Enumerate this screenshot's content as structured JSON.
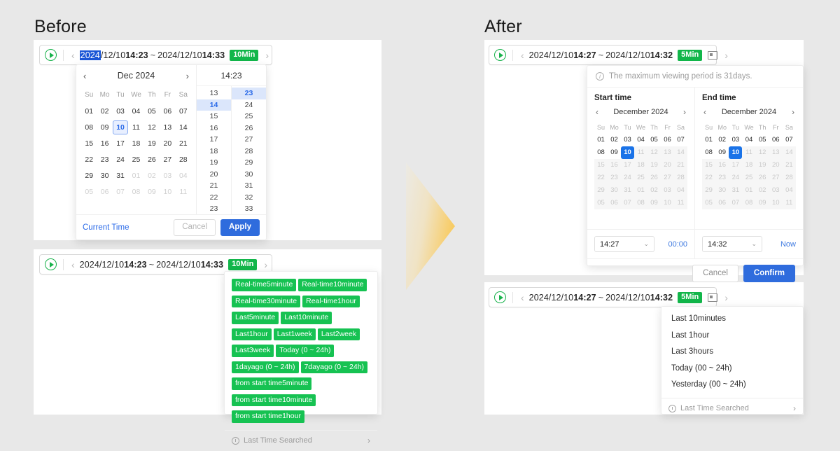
{
  "headings": {
    "before": "Before",
    "after": "After"
  },
  "icons": {
    "play": "play-circle-icon",
    "prev": "‹",
    "next": "›",
    "chevron_down": "⌄",
    "clock": "clock-history-icon",
    "info": "i"
  },
  "before": {
    "bar1": {
      "year_selected": "2024",
      "start_rest": "/12/10",
      "start_time": "14:23",
      "tilde": "~",
      "end_date": "2024/12/10",
      "end_time": "14:33",
      "interval_badge": "10Min"
    },
    "picker": {
      "cal_prev": "‹",
      "cal_label": "Dec 2024",
      "cal_next": "›",
      "dow": [
        "Su",
        "Mo",
        "Tu",
        "We",
        "Th",
        "Fr",
        "Sa"
      ],
      "weeks": [
        [
          "01",
          "02",
          "03",
          "04",
          "05",
          "06",
          "07"
        ],
        [
          "08",
          "09",
          "10",
          "11",
          "12",
          "13",
          "14"
        ],
        [
          "15",
          "16",
          "17",
          "18",
          "19",
          "20",
          "21"
        ],
        [
          "22",
          "23",
          "24",
          "25",
          "26",
          "27",
          "28"
        ],
        [
          "29",
          "30",
          "31",
          "01",
          "02",
          "03",
          "04"
        ],
        [
          "05",
          "06",
          "07",
          "08",
          "09",
          "10",
          "11"
        ]
      ],
      "selected_day": "10",
      "time_header": "14:23",
      "hours": [
        "13",
        "14",
        "15",
        "16",
        "17",
        "18",
        "19",
        "20",
        "21",
        "22",
        "23"
      ],
      "hour_selected": "14",
      "minutes": [
        "23",
        "24",
        "25",
        "26",
        "27",
        "28",
        "29",
        "30",
        "31",
        "32",
        "33"
      ],
      "minute_selected": "23",
      "current_time_link": "Current Time",
      "cancel": "Cancel",
      "apply": "Apply"
    },
    "bar2": {
      "start_date": "2024/12/10",
      "start_time": "14:23",
      "tilde": "~",
      "end_date": "2024/12/10",
      "end_time": "14:33",
      "interval_badge": "10Min"
    },
    "quick_tags": [
      "Real-time5minute",
      "Real-time10minute",
      "Real-time30minute",
      "Real-time1hour",
      "Last5minute",
      "Last10minute",
      "Last1hour",
      "Last1week",
      "Last2week",
      "Last3week",
      "Today (0 ~ 24h)",
      "1dayago (0 ~ 24h)",
      "7dayago (0 ~ 24h)",
      "from start time5minute",
      "from start time10minute",
      "from start time1hour"
    ],
    "quick_footer": "Last Time Searched"
  },
  "after": {
    "bar1": {
      "start_date": "2024/12/10",
      "start_time": "14:27",
      "tilde": "~",
      "end_date": "2024/12/10",
      "end_time": "14:32",
      "interval_badge": "5Min"
    },
    "picker": {
      "info_text": "The maximum viewing period is 31days.",
      "start_title": "Start time",
      "end_title": "End time",
      "month_label": "December 2024",
      "prev": "‹",
      "next": "›",
      "dow": [
        "Su",
        "Mo",
        "Tu",
        "We",
        "Th",
        "Fr",
        "Sa"
      ],
      "weeks": [
        [
          "01",
          "02",
          "03",
          "04",
          "05",
          "06",
          "07"
        ],
        [
          "08",
          "09",
          "10",
          "11",
          "12",
          "13",
          "14"
        ],
        [
          "15",
          "16",
          "17",
          "18",
          "19",
          "20",
          "21"
        ],
        [
          "22",
          "23",
          "24",
          "25",
          "26",
          "27",
          "28"
        ],
        [
          "29",
          "30",
          "31",
          "01",
          "02",
          "03",
          "04"
        ],
        [
          "05",
          "06",
          "07",
          "08",
          "09",
          "10",
          "11"
        ]
      ],
      "today": "10",
      "start_time_value": "14:27",
      "end_time_value": "14:32",
      "zero_link": "00:00",
      "now_link": "Now",
      "cancel": "Cancel",
      "confirm": "Confirm"
    },
    "bar2": {
      "start_date": "2024/12/10",
      "start_time": "14:27",
      "tilde": "~",
      "end_date": "2024/12/10",
      "end_time": "14:32",
      "interval_badge": "5Min"
    },
    "list_items": [
      "Last 10minutes",
      "Last 1hour",
      "Last 3hours",
      "Today (00 ~ 24h)",
      "Yesterday (00 ~ 24h)"
    ],
    "list_footer": "Last Time Searched"
  },
  "colors": {
    "green_badge": "#12b64a",
    "green_tag": "#16c252",
    "blue_primary": "#2f6cdd",
    "blue_today": "#1a73e8",
    "arrow_gradient_end": "#f8c23c"
  }
}
